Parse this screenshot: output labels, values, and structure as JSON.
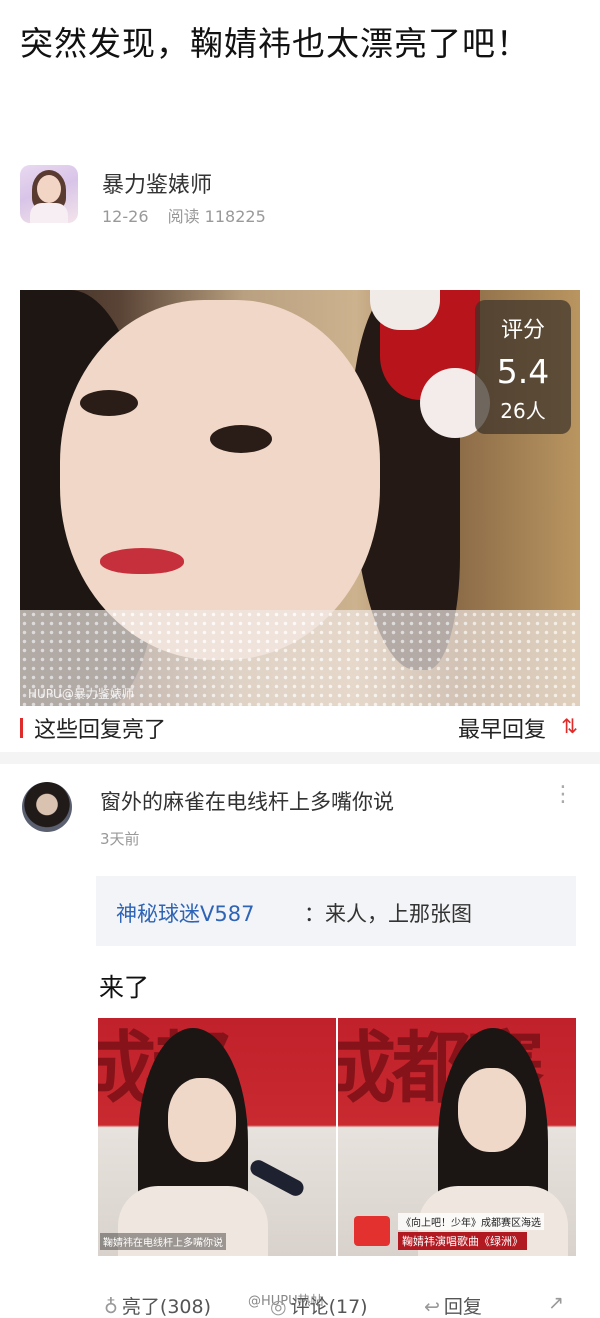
{
  "post": {
    "title": "突然发现，鞠婧祎也太漂亮了吧！"
  },
  "author": {
    "name": "暴力鉴婊师",
    "date": "12-26",
    "reads_label": "阅读 118225",
    "avatar_icon": "avatar-girl"
  },
  "photo": {
    "watermark": "HUPU@暴力鉴婊师",
    "rating": {
      "label": "评分",
      "value": "5.4",
      "count": "26人"
    }
  },
  "replies": {
    "section_label": "这些回复亮了",
    "sort_label": "最早回复",
    "sort_icon": "⇅",
    "accent": "#e02b2b"
  },
  "comment": {
    "username": "窗外的麻雀在电线杆上多嘴你说",
    "time": "3天前",
    "more_icon": "⋮",
    "quote_user": "神秘球迷V587",
    "quote_text": "：来人，上那张图",
    "body": "来了",
    "images": {
      "left_caption": "鞠婧祎在电线杆上多嘴你说",
      "right_caption_top": "《向上吧！少年》成都赛区海选",
      "right_caption_bottom": "鞠婧祎演唱歌曲《绿洲》",
      "bg_text_a": "成都",
      "bg_text_b": "成都赛"
    }
  },
  "actions": {
    "like": "亮了(308)",
    "comment": "评论(17)",
    "reply": "回复",
    "like_icon": "♁",
    "comment_icon": "◎",
    "reply_icon": "↩",
    "share_icon": "↗",
    "watermark": "@HUPU热帖"
  }
}
